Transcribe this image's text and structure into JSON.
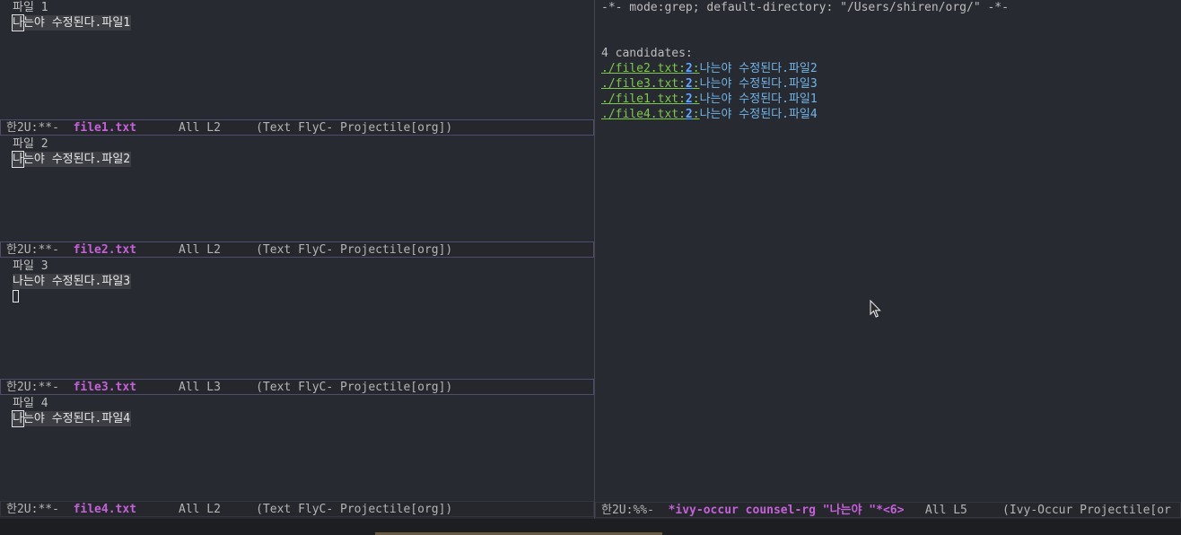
{
  "windows": [
    {
      "title": "파일 1",
      "content": "나는야 수정된다.파일1",
      "cursor_char": "나",
      "content_rest": "는야 수정된다.파일1",
      "modeline": {
        "prefix": "한2U:**-",
        "filename": "file1.txt",
        "position": "All L2",
        "modes": "(Text FlyC- Projectile[org])"
      }
    },
    {
      "title": "파일 2",
      "content": "나는야 수정된다.파일2",
      "cursor_char": "나",
      "content_rest": "는야 수정된다.파일2",
      "modeline": {
        "prefix": "한2U:**-",
        "filename": "file2.txt",
        "position": "All L2",
        "modes": "(Text FlyC- Projectile[org])"
      }
    },
    {
      "title": "파일 3",
      "content": "나는야 수정된다.파일3",
      "modeline": {
        "prefix": "한2U:**-",
        "filename": "file3.txt",
        "position": "All L3",
        "modes": "(Text FlyC- Projectile[org])"
      }
    },
    {
      "title": "파일 4",
      "content": "나는야 수정된다.파일4",
      "cursor_char": "나",
      "content_rest": "는야 수정된다.파일4",
      "modeline": {
        "prefix": "한2U:**-",
        "filename": "file4.txt",
        "position": "All L2",
        "modes": "(Text FlyC- Projectile[org])"
      }
    }
  ],
  "occur": {
    "header": "-*- mode:grep; default-directory: \"/Users/shiren/org/\" -*-",
    "candidates_label": "4 candidates:",
    "candidates": [
      {
        "file": "./file2.txt",
        "line": "2",
        "text": "나는야 수정된다.파일2"
      },
      {
        "file": "./file3.txt",
        "line": "2",
        "text": "나는야 수정된다.파일3"
      },
      {
        "file": "./file1.txt",
        "line": "2",
        "text": "나는야 수정된다.파일1"
      },
      {
        "file": "./file4.txt",
        "line": "2",
        "text": "나는야 수정된다.파일4"
      }
    ],
    "modeline": {
      "prefix": "한2U:%%-",
      "buffer": "*ivy-occur counsel-rg \"나는야 \"*<6>",
      "position": "All L5",
      "modes": "(Ivy-Occur Projectile[or"
    }
  },
  "colors": {
    "background": "#282a31",
    "buffer_name": "#c561d8",
    "link_green": "#7ec84d",
    "line_number_blue": "#5fa8ff",
    "match_text": "#71b5e8"
  }
}
